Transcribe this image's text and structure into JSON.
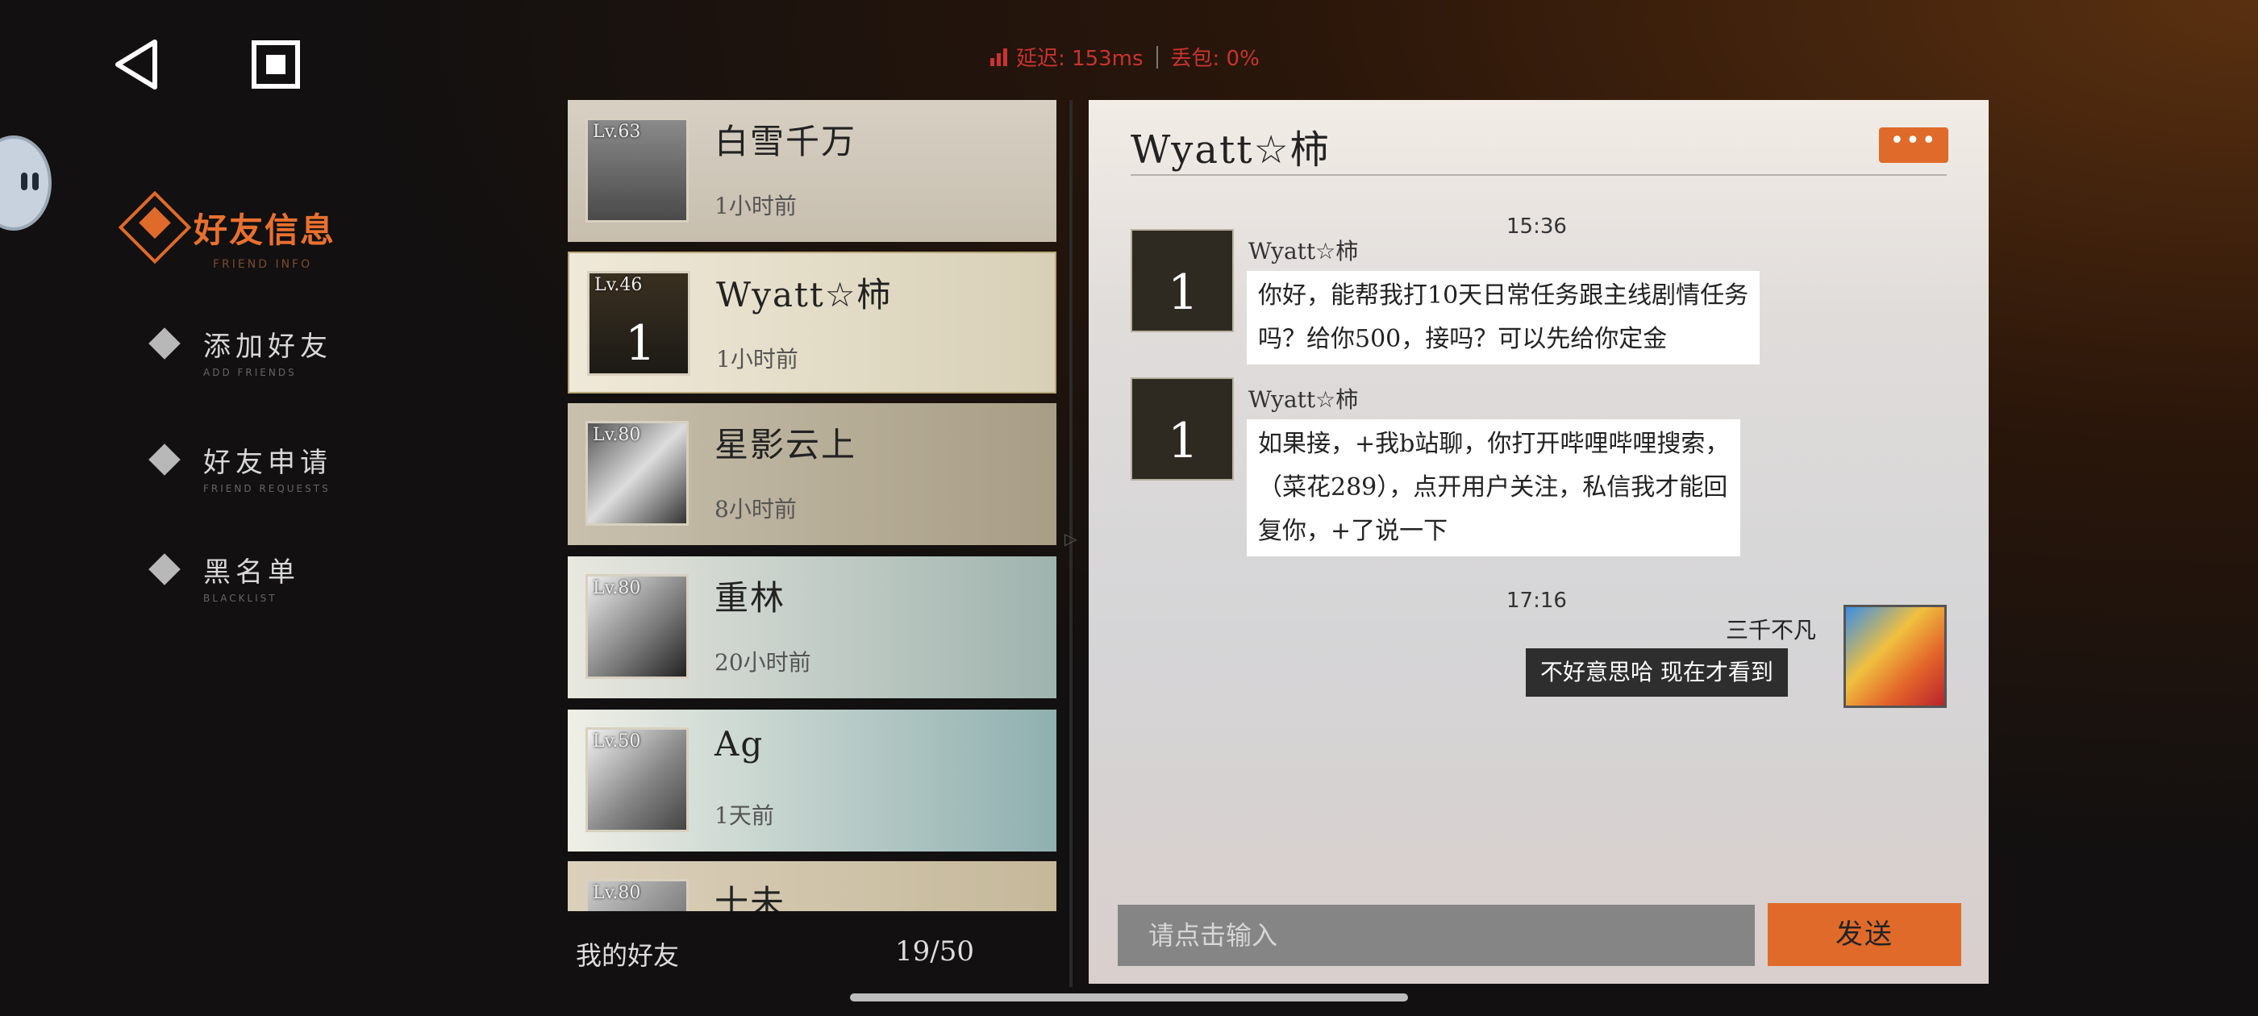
{
  "nav": {
    "back_icon": "back-triangle-icon",
    "stop_icon": "square-stop-icon"
  },
  "network": {
    "latency": "延迟: 153ms",
    "loss": "丢包: 0%",
    "signal_color": "#c8342f"
  },
  "menu": {
    "title": "好友信息",
    "title_sub": "FRIEND INFO",
    "items": [
      {
        "label": "添加好友",
        "sub": "ADD FRIENDS"
      },
      {
        "label": "好友申请",
        "sub": "FRIEND REQUESTS"
      },
      {
        "label": "黑名单",
        "sub": "BLACKLIST"
      }
    ]
  },
  "friends": [
    {
      "level": "Lv.63",
      "name": "白雪千万",
      "time": "1小时前"
    },
    {
      "level": "Lv.46",
      "name": "Wyatt☆柿",
      "time": "1小时前",
      "selected": true
    },
    {
      "level": "Lv.80",
      "name": "星影云上",
      "time": "8小时前"
    },
    {
      "level": "Lv.80",
      "name": "重林",
      "time": "20小时前"
    },
    {
      "level": "Lv.50",
      "name": "Ag",
      "time": "1天前"
    },
    {
      "level": "Lv.80",
      "name": "十未",
      "time": ""
    }
  ],
  "friends_footer": {
    "label": "我的好友",
    "count": "19/50"
  },
  "chat": {
    "title": "Wyatt☆柿",
    "more_label": "•••",
    "messages": [
      {
        "time": "15:36",
        "sender": "Wyatt☆柿",
        "lines": [
          "你好，能帮我打10天日常任务跟主线剧情任务",
          "吗？给你500，接吗？可以先给你定金"
        ]
      },
      {
        "sender": "Wyatt☆柿",
        "lines": [
          "如果接，+我b站聊，你打开哔哩哔哩搜索，",
          "（菜花289），点开用户关注，私信我才能回",
          "复你，+了说一下"
        ]
      }
    ],
    "my_message": {
      "time": "17:16",
      "sender": "三千不凡",
      "text": "不好意思哈 现在才看到"
    },
    "input_placeholder": "请点击输入",
    "send_label": "发送",
    "accent": "#e06a2a"
  }
}
